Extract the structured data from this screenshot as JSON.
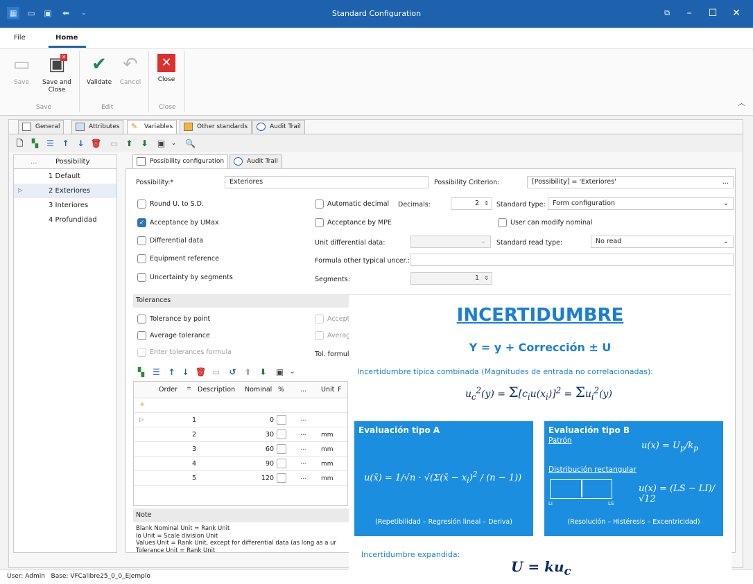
{
  "window": {
    "title": "Standard Configuration"
  },
  "menu": {
    "file": "File",
    "home": "Home"
  },
  "ribbon": {
    "save": "Save",
    "save_close": "Save and Close",
    "validate": "Validate",
    "cancel": "Cancel",
    "close": "Close",
    "grp_save": "Save",
    "grp_edit": "Edit",
    "grp_close": "Close"
  },
  "tabs": {
    "general": "General",
    "attributes": "Attributes",
    "variables": "Variables",
    "other": "Other standards",
    "audit": "Audit Trail"
  },
  "left_grid": {
    "header_dots": "...",
    "header": "Possibility",
    "rows": [
      "1 Default",
      "2 Exteriores",
      "3 Interiores",
      "4 Profundidad"
    ]
  },
  "subtabs": {
    "config": "Possibility configuration",
    "audit": "Audit Trail"
  },
  "form": {
    "possibility_label": "Possibility:*",
    "possibility_value": "Exteriores",
    "criterion_label": "Possibility Criterion:",
    "criterion_value": "[Possibility] = 'Exteriores'",
    "criterion_btn": "...",
    "round": "Round U. to S.D.",
    "auto_decimal": "Automatic decimal",
    "decimals_label": "Decimals:",
    "decimals_value": "2",
    "std_type_label": "Standard type:",
    "std_type_value": "Form configuration",
    "accept_umax": "Acceptance by UMax",
    "accept_mpe": "Acceptance by MPE",
    "user_modify": "User can modify nominal",
    "differential": "Differential data",
    "unit_diff_label": "Unit differential data:",
    "std_read_label": "Standard read type:",
    "std_read_value": "No read",
    "equip_ref": "Equipment reference",
    "formula_label": "Formula other typical uncer.:",
    "unc_segments": "Uncertainty by segments",
    "segments_label": "Segments:",
    "segments_value": "1"
  },
  "tolerances": {
    "title": "Tolerances",
    "by_point": "Tolerance by point",
    "average": "Average tolerance",
    "enter_formula": "Enter tolerances formula",
    "formula_label": "Tol. formul",
    "accept_partial": "Accept",
    "average_partial": "Averag"
  },
  "tol_grid": {
    "headers": [
      "Order",
      "Description",
      "Nominal",
      "%",
      "...",
      "Unit",
      "F"
    ],
    "rows": [
      {
        "order": "1",
        "nominal": "0",
        "unit": ""
      },
      {
        "order": "2",
        "nominal": "30",
        "unit": "mm"
      },
      {
        "order": "3",
        "nominal": "60",
        "unit": "mm"
      },
      {
        "order": "4",
        "nominal": "90",
        "unit": "mm"
      },
      {
        "order": "5",
        "nominal": "120",
        "unit": "mm"
      }
    ],
    "ellipsis": "..."
  },
  "note": {
    "title": "Note",
    "lines": [
      "Blank Nominal Unit = Rank Unit",
      "Io Unit = Scale division Unit",
      "Values Unit = Rank Unit, except for differential data (as long as a ur",
      "Tolerance Unit = Rank Unit"
    ]
  },
  "status": {
    "text": "User: Admin   Base: VFCalibre25_0_0_Ejemplo"
  },
  "overlay": {
    "title": "INCERTIDUMBRE",
    "formula": "Y = y + Corrección ± U",
    "combined": "Incertidumbre típica combinada (Magnitudes de entrada no correlacionadas):",
    "typeA": "Evaluación tipo A",
    "typeA_foot": "(Repetibilidad – Regresión lineal – Deriva)",
    "typeB": "Evaluación tipo B",
    "patron": "Patrón",
    "rect": "Distribución rectangular",
    "li": "LI",
    "ls": "LS",
    "typeB_foot": "(Resolución – Histéresis – Excentricidad)",
    "expanded": "Incertidumbre expandida:"
  },
  "colors": {
    "titlebar": "#1e62ad",
    "accent_blue": "#1c8ee0",
    "validate_green": "#1f8a4c",
    "close_red": "#e02d2d"
  }
}
